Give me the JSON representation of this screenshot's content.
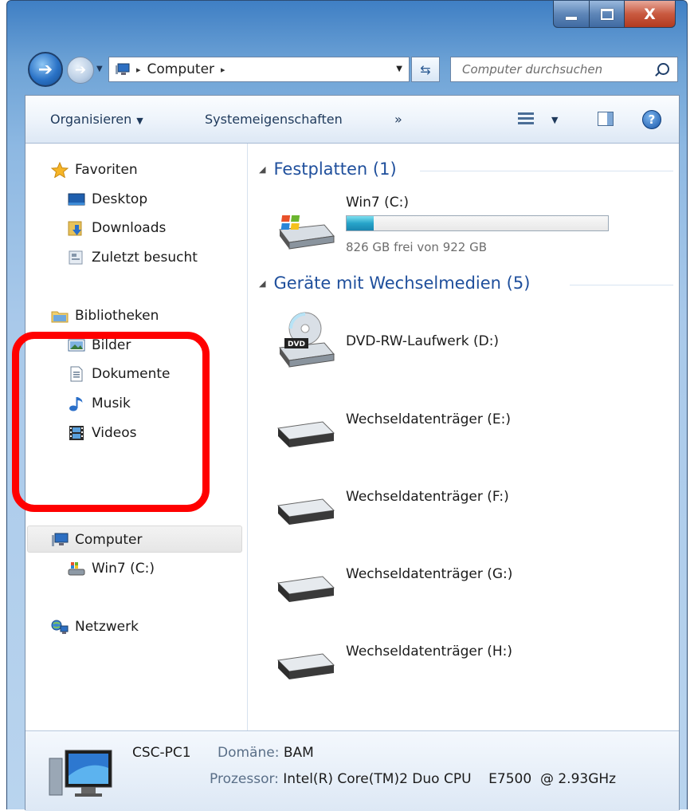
{
  "window": {
    "caption": {
      "minimize_glyph": "minimize",
      "maximize_glyph": "maximize",
      "close_glyph": "X"
    }
  },
  "nav": {
    "back_icon": "back-arrow-icon",
    "forward_icon": "forward-arrow-icon"
  },
  "address": {
    "path": "Computer",
    "separator": "▸"
  },
  "search": {
    "placeholder": "Computer durchsuchen"
  },
  "toolbar": {
    "organize_label": "Organisieren",
    "system_props_label": "Systemeigenschaften",
    "more_label": "»"
  },
  "sidebar": {
    "favorites": {
      "label": "Favoriten",
      "items": [
        "Desktop",
        "Downloads",
        "Zuletzt besucht"
      ]
    },
    "libraries": {
      "label": "Bibliotheken",
      "items": [
        "Bilder",
        "Dokumente",
        "Musik",
        "Videos"
      ]
    },
    "computer": {
      "label": "Computer",
      "items": [
        "Win7 (C:)"
      ]
    },
    "network": {
      "label": "Netzwerk"
    }
  },
  "main": {
    "hard_drives": {
      "header": "Festplatten (1)",
      "drives": [
        {
          "name": "Win7 (C:)",
          "free_text": "826 GB frei von 922 GB",
          "used_fraction": 0.104
        }
      ]
    },
    "removable": {
      "header": "Geräte mit Wechselmedien (5)",
      "devices": [
        {
          "name": "DVD-RW-Laufwerk (D:)",
          "icon": "dvd-drive-icon",
          "badge": "DVD"
        },
        {
          "name": "Wechseldatenträger (E:)",
          "icon": "removable-drive-icon"
        },
        {
          "name": "Wechseldatenträger (F:)",
          "icon": "removable-drive-icon"
        },
        {
          "name": "Wechseldatenträger (G:)",
          "icon": "removable-drive-icon"
        },
        {
          "name": "Wechseldatenträger (H:)",
          "icon": "removable-drive-icon"
        }
      ]
    }
  },
  "details": {
    "computer_name": "CSC-PC1",
    "domain_label": "Domäne:",
    "domain_value": "BAM",
    "processor_label": "Prozessor:",
    "processor_value": "Intel(R) Core(TM)2 Duo CPU    E7500  @ 2.93GHz"
  },
  "colors": {
    "highlight": "#ff0000",
    "link_blue": "#1f4f9c",
    "bar_fill": "#27a4c9"
  }
}
